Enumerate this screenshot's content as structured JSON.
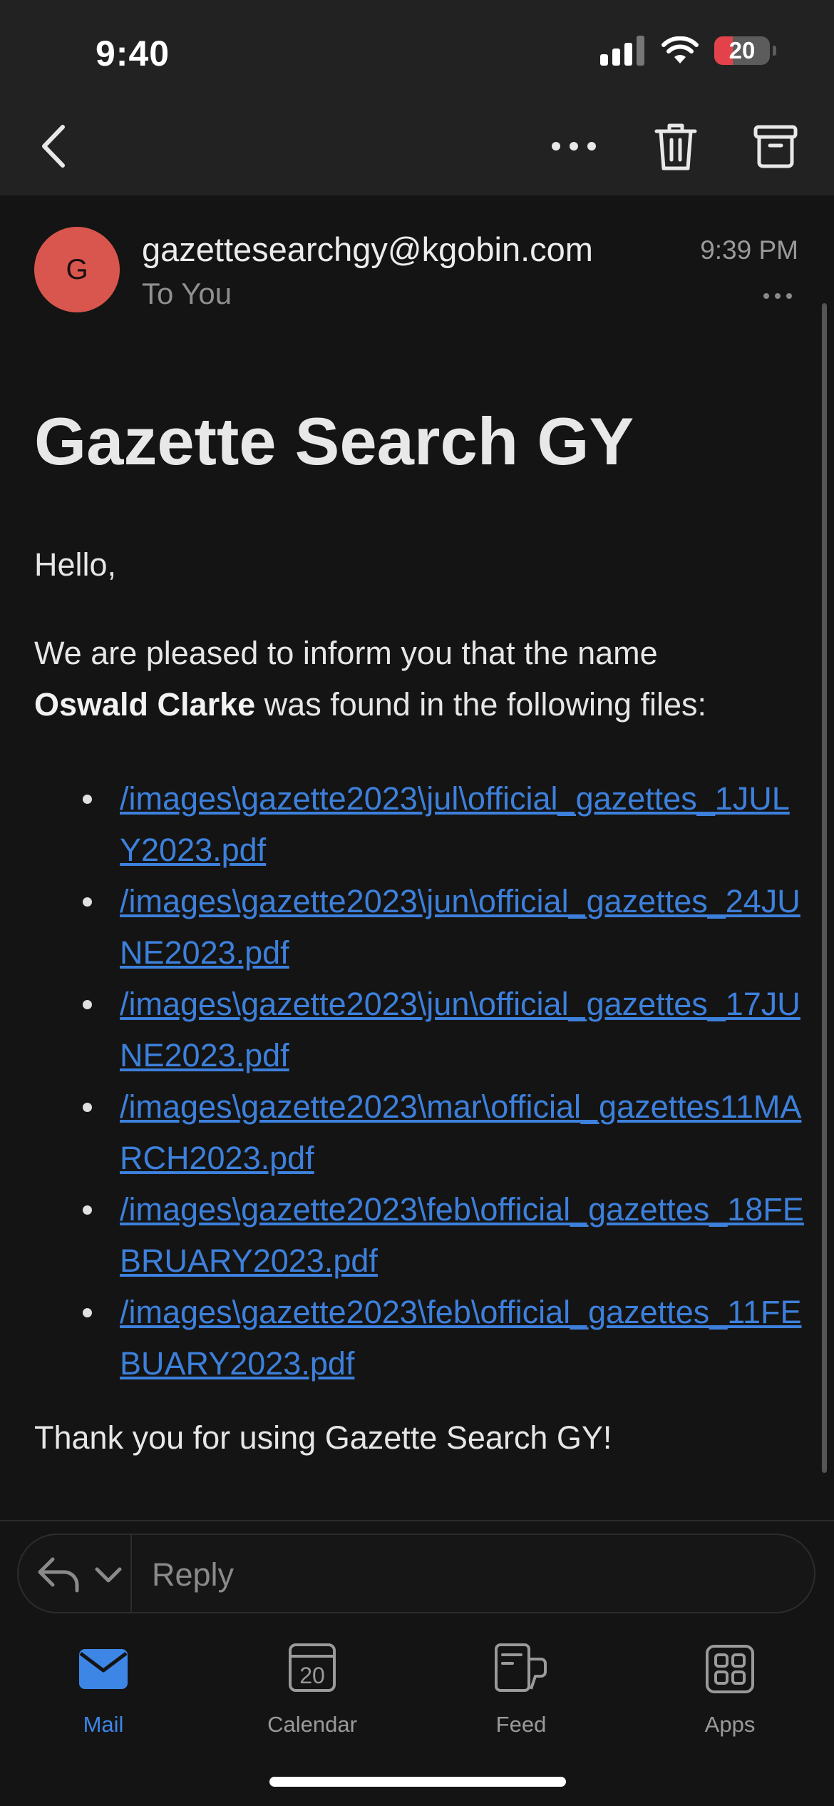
{
  "status_bar": {
    "time": "9:40",
    "battery": "20",
    "icons": [
      "cellular-signal-icon",
      "wifi-icon",
      "battery-icon"
    ]
  },
  "nav": {
    "icons": [
      "back-chevron-icon",
      "more-horizontal-icon",
      "trash-icon",
      "archive-icon"
    ]
  },
  "email": {
    "avatar_initial": "G",
    "from": "gazettesearchgy@kgobin.com",
    "to": "To You",
    "time": "9:39 PM",
    "subject": "Gazette Search GY",
    "greeting": "Hello,",
    "intro_before": "We are pleased to inform you that the name",
    "name_found": "Oswald Clarke",
    "intro_after": "was found in the following files:",
    "files": [
      "/images\\gazette2023\\jul\\official_gazettes_1JULY2023.pdf",
      "/images\\gazette2023\\jun\\official_gazettes_24JUNE2023.pdf",
      "/images\\gazette2023\\jun\\official_gazettes_17JUNE2023.pdf",
      "/images\\gazette2023\\mar\\official_gazettes11MARCH2023.pdf",
      "/images\\gazette2023\\feb\\official_gazettes_18FEBRUARY2023.pdf",
      "/images\\gazette2023\\feb\\official_gazettes_11FEBUARY2023.pdf"
    ],
    "closing": "Thank you for using Gazette Search GY!"
  },
  "reply": {
    "placeholder": "Reply"
  },
  "tabs": [
    {
      "label": "Mail",
      "icon": "mail-icon",
      "active": true
    },
    {
      "label": "Calendar",
      "icon": "calendar-icon",
      "day": "20",
      "active": false
    },
    {
      "label": "Feed",
      "icon": "feed-icon",
      "active": false
    },
    {
      "label": "Apps",
      "icon": "apps-grid-icon",
      "active": false
    }
  ],
  "colors": {
    "accent": "#3d86e6",
    "avatar": "#d8564d",
    "link": "#3d80dc",
    "background": "#141414",
    "toolbar": "#222222"
  }
}
